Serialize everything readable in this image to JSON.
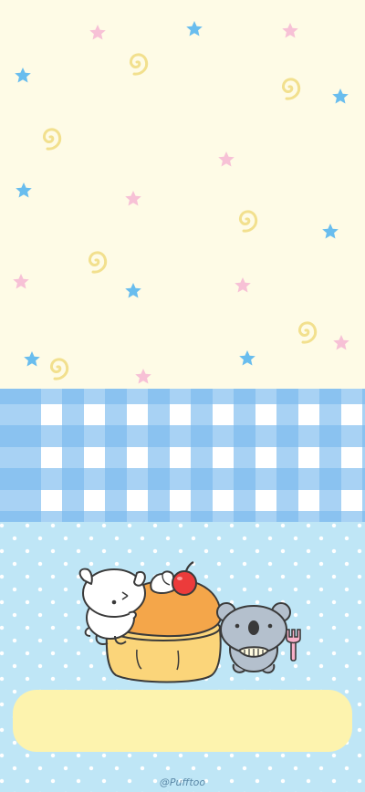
{
  "image": {
    "credit": "@Pufftoo",
    "colors": {
      "cream_background": "#fefbe6",
      "star_blue": "#69bdee",
      "star_pink": "#f7c1d6",
      "swirl_yellow": "#f2e08e",
      "gingham_blue": "#7abaee",
      "dot_background": "#bfe6f6",
      "pudding": "#fbd57a",
      "caramel": "#f4a64a",
      "cherry": "#ec3b3b",
      "plate": "#fdf3ae"
    },
    "characters": [
      "white-puppy",
      "grey-koala",
      "custard-pudding",
      "cherry",
      "whipped-cream",
      "pink-fork"
    ]
  }
}
